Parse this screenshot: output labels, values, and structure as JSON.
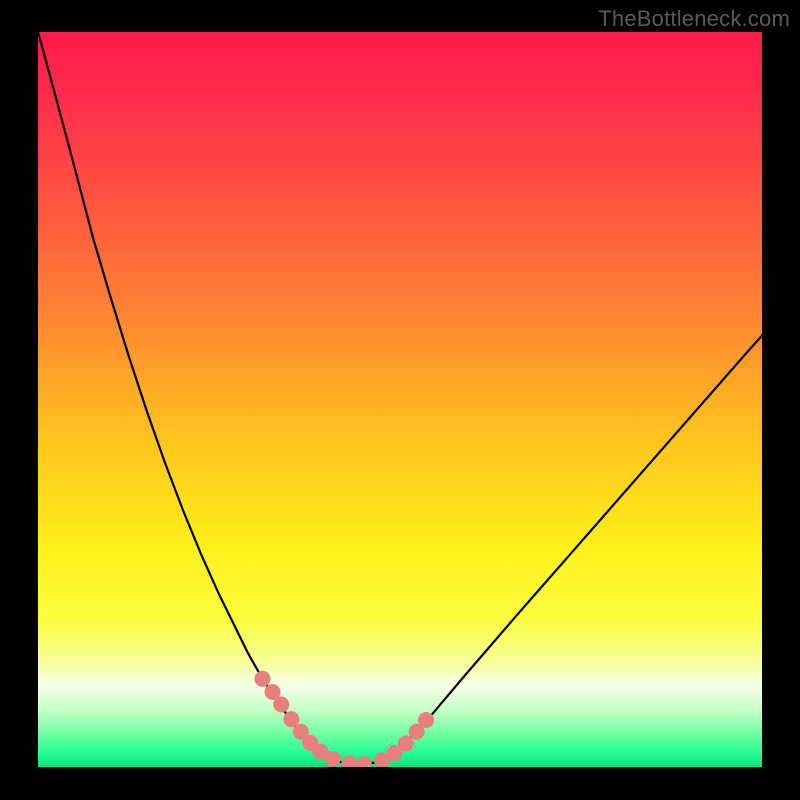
{
  "watermark": "TheBottleneck.com",
  "chart_meta": {
    "background": "#000000",
    "gradient_stops": [
      {
        "offset": 0.0,
        "color": "#ff1a4b"
      },
      {
        "offset": 0.1,
        "color": "#ff2f4b"
      },
      {
        "offset": 0.25,
        "color": "#ff5a3e"
      },
      {
        "offset": 0.4,
        "color": "#ff8a32"
      },
      {
        "offset": 0.55,
        "color": "#ffc21f"
      },
      {
        "offset": 0.7,
        "color": "#fff01a"
      },
      {
        "offset": 0.8,
        "color": "#fbff3e"
      },
      {
        "offset": 0.86,
        "color": "#f7ffa0"
      },
      {
        "offset": 0.89,
        "color": "#f4ffe8"
      },
      {
        "offset": 0.92,
        "color": "#c9ffc7"
      },
      {
        "offset": 0.95,
        "color": "#7dffa8"
      },
      {
        "offset": 0.98,
        "color": "#27ff95"
      },
      {
        "offset": 1.0,
        "color": "#00e37a"
      }
    ],
    "curve_color": "#000000",
    "marker_color": "#e97f7d"
  },
  "chart_data": {
    "type": "line",
    "title": "",
    "xlabel": "",
    "ylabel": "",
    "xlim": [
      0,
      100
    ],
    "ylim": [
      0,
      100
    ],
    "series": [
      {
        "name": "bottleneck-curve",
        "x": [
          0.0,
          2.5,
          4.8,
          7.6,
          10.0,
          12.5,
          15.0,
          17.5,
          20.0,
          22.5,
          25.0,
          27.0,
          29.0,
          31.0,
          33.0,
          35.2,
          37.0,
          38.5,
          40.0,
          42.0,
          44.0,
          45.0,
          47.0,
          50.0,
          53.0,
          56.0,
          59.0,
          62.5,
          66.0,
          70.0,
          74.0,
          78.0,
          82.0,
          86.0,
          90.0,
          94.0,
          98.0,
          100.0
        ],
        "y": [
          100.0,
          91.0,
          82.5,
          72.0,
          64.0,
          56.0,
          48.5,
          41.5,
          35.0,
          29.0,
          23.5,
          19.5,
          15.5,
          12.0,
          9.0,
          6.0,
          3.8,
          2.3,
          1.3,
          0.6,
          0.35,
          0.35,
          0.7,
          2.5,
          5.5,
          9.0,
          12.5,
          16.5,
          20.5,
          25.0,
          29.5,
          34.0,
          38.5,
          43.0,
          47.5,
          52.0,
          56.5,
          58.7
        ]
      }
    ],
    "markers": {
      "name": "highlighted-points",
      "x": [
        31.0,
        32.4,
        33.6,
        35.0,
        36.3,
        37.6,
        39.0,
        40.7,
        43.0,
        45.0,
        47.5,
        49.2,
        50.8,
        52.3,
        53.6
      ],
      "y": [
        12.0,
        10.2,
        8.5,
        6.5,
        4.8,
        3.3,
        2.1,
        1.1,
        0.5,
        0.4,
        0.9,
        1.9,
        3.2,
        4.8,
        6.4
      ]
    }
  }
}
